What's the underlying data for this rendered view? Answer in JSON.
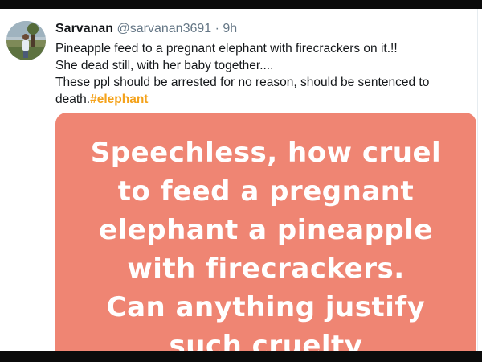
{
  "tweet": {
    "author_name": "Sarvanan",
    "author_handle": "@sarvanan3691",
    "separator": "·",
    "time": "9h",
    "lines": [
      "Pineapple feed to a pregnant elephant with firecrackers on it.!!",
      "She dead still, with her baby together....",
      "These ppl should be arrested for no reason, should be sentenced to"
    ],
    "last_line_prefix": "death.",
    "hashtag": "#elephant",
    "media": {
      "lines": [
        "Speechless, how cruel",
        "to feed a pregnant",
        "elephant a pineapple",
        "with firecrackers.",
        "Can anything justify",
        "such cruelty"
      ],
      "background_color": "#ef8573",
      "text_color": "#ffffff"
    }
  },
  "colors": {
    "hashtag": "#f4a21a",
    "secondary_text": "#657786",
    "primary_text": "#14171a"
  }
}
